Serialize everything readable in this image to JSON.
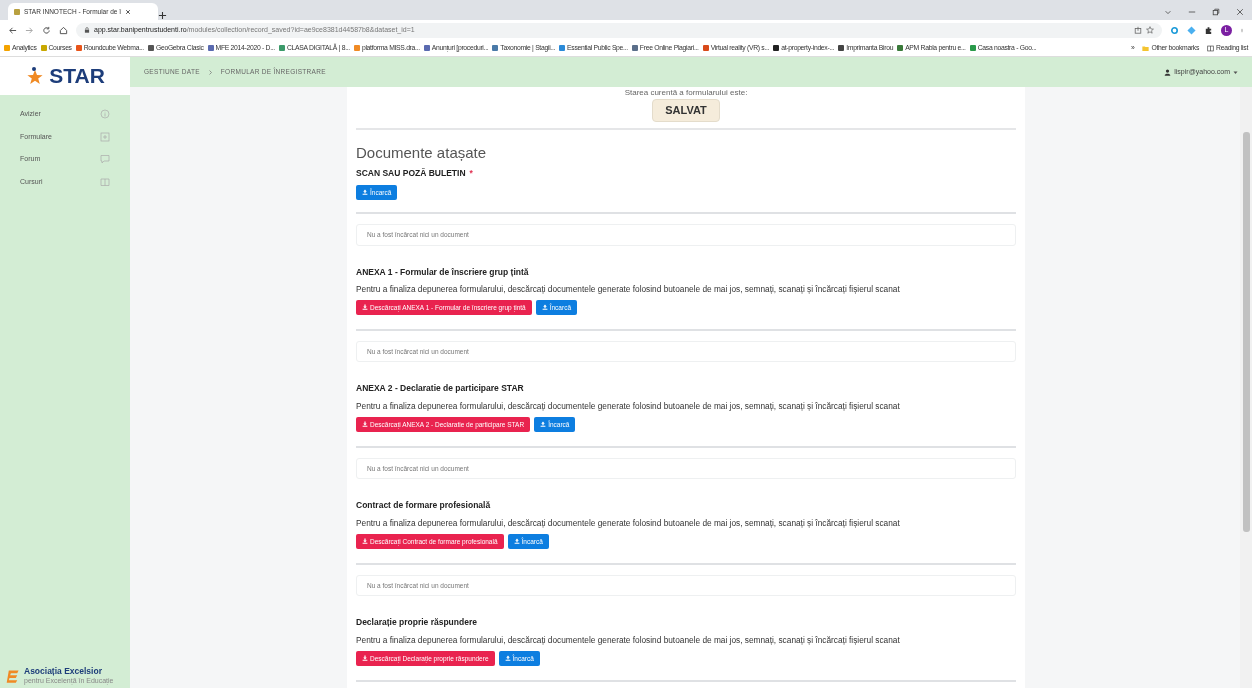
{
  "browser": {
    "tab_title": "STAR INNOTECH - Formular de î",
    "url_host": "app.star.banipentrustudenti.ro",
    "url_path": "/modules/collection/record_saved?id=ae9ce8381d44587b8&dataset_id=1",
    "profile_initial": "L",
    "bookmarks": [
      {
        "label": "Analytics",
        "color": "#f4a300"
      },
      {
        "label": "Courses",
        "color": "#c8a800"
      },
      {
        "label": "Roundcube Webma...",
        "color": "#e8541a"
      },
      {
        "label": "GeoGebra Clasic",
        "color": "#555555"
      },
      {
        "label": "MFE 2014-2020 - D...",
        "color": "#5a6ab0"
      },
      {
        "label": "CLASA DIGITALĂ | 8...",
        "color": "#3c9a6a"
      },
      {
        "label": "platforma MISS.dra...",
        "color": "#f08a24"
      },
      {
        "label": "Anunțuri [proceduri...",
        "color": "#5a6ab0"
      },
      {
        "label": "Taxonomie | Stagii...",
        "color": "#4a7aa8"
      },
      {
        "label": "Essential Public Spe...",
        "color": "#2a8ad8"
      },
      {
        "label": "Free Online Plagiari...",
        "color": "#5b6f8a"
      },
      {
        "label": "Virtual reality (VR) s...",
        "color": "#d84a1a"
      },
      {
        "label": "at-property-index-...",
        "color": "#222222"
      },
      {
        "label": "Imprimanta Birou",
        "color": "#444444"
      },
      {
        "label": "APM Rabla pentru e...",
        "color": "#3a7a3a"
      },
      {
        "label": "Casa noastra - Goo...",
        "color": "#2a9a4a"
      }
    ],
    "more": "»",
    "other_bookmarks": "Other bookmarks",
    "reading_list": "Reading list"
  },
  "app": {
    "logo": "STAR",
    "breadcrumb": [
      "GESTIUNE DATE",
      "FORMULAR DE ÎNREGISTRARE"
    ],
    "user": "lispir@yahoo.com",
    "sidebar": [
      {
        "label": "Avizier"
      },
      {
        "label": "Formulare"
      },
      {
        "label": "Forum"
      },
      {
        "label": "Cursuri"
      }
    ],
    "footer_logo": {
      "name": "Asociația Excelsior",
      "tagline": "pentru Excelență în Educație"
    }
  },
  "status": {
    "label": "Starea curentă a formularului este:",
    "value": "SALVAT"
  },
  "heading": "Documente atașate",
  "sections": [
    {
      "title": "SCAN SAU POZĂ BULETIN",
      "required_marker": "*",
      "upload": "Încarcă",
      "empty": "Nu a fost încărcat nici un document"
    },
    {
      "title": "ANEXA 1 - Formular de înscriere grup țintă",
      "description": "Pentru a finaliza depunerea formularului, descărcați documentele generate folosind butoanele de mai jos, semnați, scanați și încărcați fișierul scanat",
      "download": "Descărcați ANEXA 1 - Formular de înscriere grup țintă",
      "upload": "Încarcă",
      "empty": "Nu a fost încărcat nici un document"
    },
    {
      "title": "ANEXA 2 - Declaratie de participare STAR",
      "description": "Pentru a finaliza depunerea formularului, descărcați documentele generate folosind butoanele de mai jos, semnați, scanați și încărcați fișierul scanat",
      "download": "Descărcați ANEXA 2 - Declaratie de participare STAR",
      "upload": "Încarcă",
      "empty": "Nu a fost încărcat nici un document"
    },
    {
      "title": "Contract de formare profesională",
      "description": "Pentru a finaliza depunerea formularului, descărcați documentele generate folosind butoanele de mai jos, semnați, scanați și încărcați fișierul scanat",
      "download": "Descărcați Contract de formare profesională",
      "upload": "Încarcă",
      "empty": "Nu a fost încărcat nici un document"
    },
    {
      "title": "Declarație proprie răspundere",
      "description": "Pentru a finaliza depunerea formularului, descărcați documentele generate folosind butoanele de mai jos, semnați, scanați și încărcați fișierul scanat",
      "download": "Descărcați Declarație proprie răspundere",
      "upload": "Încarcă"
    }
  ]
}
